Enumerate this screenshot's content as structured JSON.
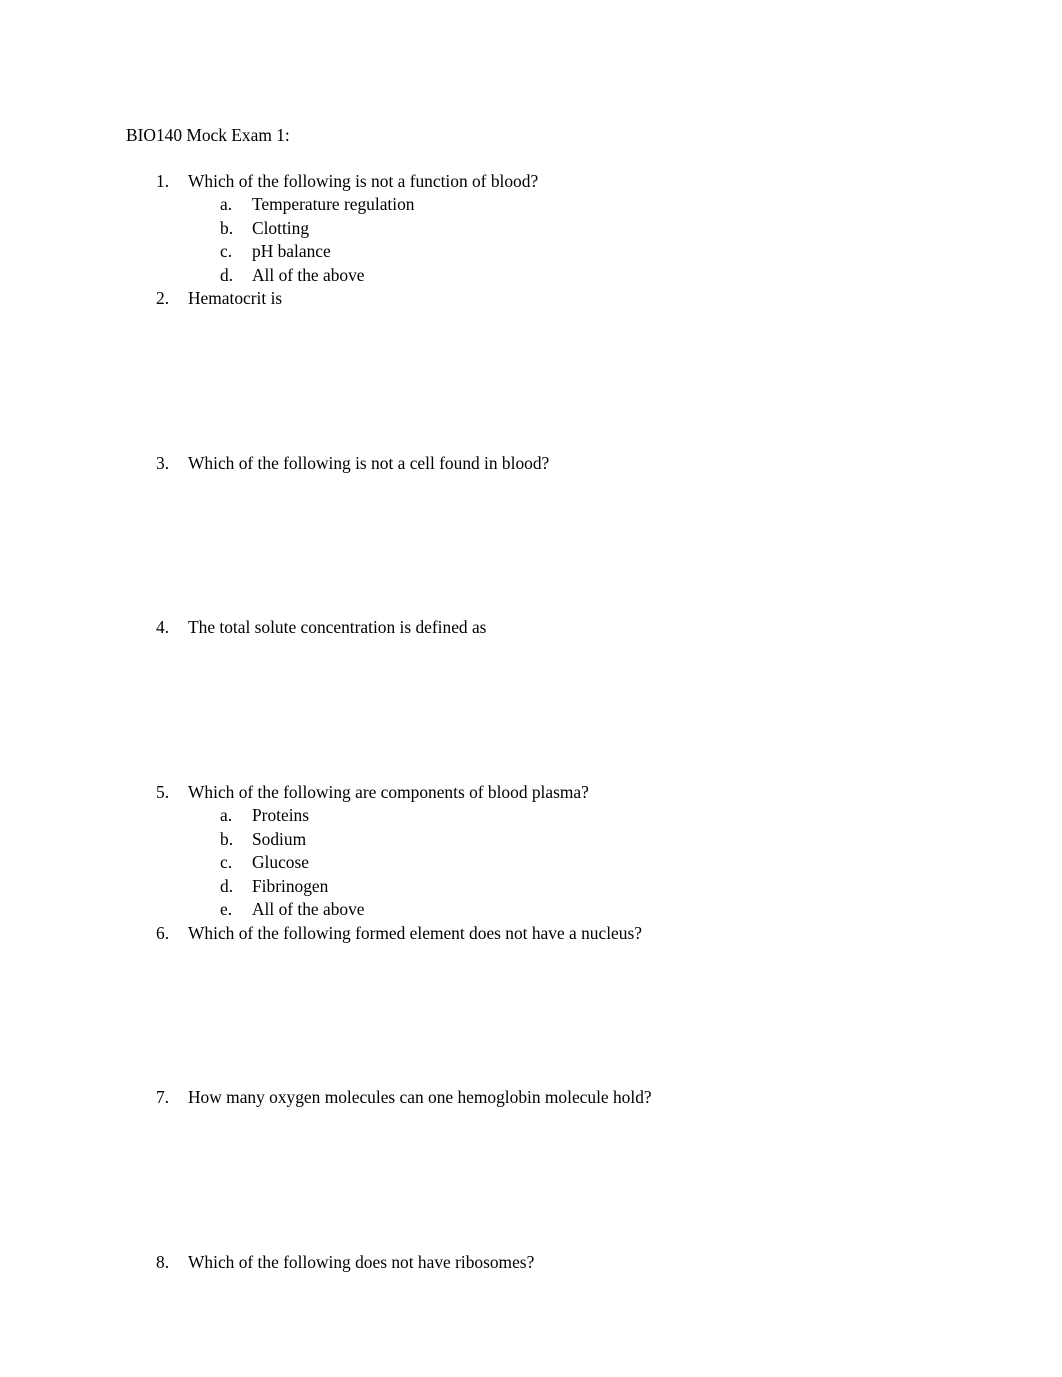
{
  "document": {
    "title": "BIO140 Mock Exam 1:",
    "page_background": "#ffffff",
    "text_color": "#000000"
  },
  "questions": [
    {
      "number": "1.",
      "text": "Which of the following is not a function of blood?",
      "answer_space_lines": 0,
      "options": [
        {
          "letter": "a.",
          "text": "Temperature regulation"
        },
        {
          "letter": "b.",
          "text": "Clotting"
        },
        {
          "letter": "c.",
          "text": "pH balance"
        },
        {
          "letter": "d.",
          "text": "All of the above"
        }
      ]
    },
    {
      "number": "2.",
      "text": "Hematocrit is",
      "answer_space_lines": 6,
      "options": []
    },
    {
      "number": "3.",
      "text": "Which of the following is not a cell found in blood?",
      "answer_space_lines": 6,
      "options": []
    },
    {
      "number": "4.",
      "text": "The total solute concentration is defined as",
      "answer_space_lines": 6,
      "options": []
    },
    {
      "number": "5.",
      "text": "Which of the following are components of blood plasma?",
      "answer_space_lines": 0,
      "options": [
        {
          "letter": "a.",
          "text": "Proteins"
        },
        {
          "letter": "b.",
          "text": "Sodium"
        },
        {
          "letter": "c.",
          "text": "Glucose"
        },
        {
          "letter": "d.",
          "text": "Fibrinogen"
        },
        {
          "letter": "e.",
          "text": "All of the above"
        }
      ]
    },
    {
      "number": "6.",
      "text": "Which of the following formed element does not have a nucleus?",
      "answer_space_lines": 6,
      "options": []
    },
    {
      "number": "7.",
      "text": "How many oxygen molecules can one hemoglobin molecule hold?",
      "answer_space_lines": 6,
      "options": []
    },
    {
      "number": "8.",
      "text": "Which of the following does not have ribosomes?",
      "answer_space_lines": 0,
      "options": []
    }
  ]
}
